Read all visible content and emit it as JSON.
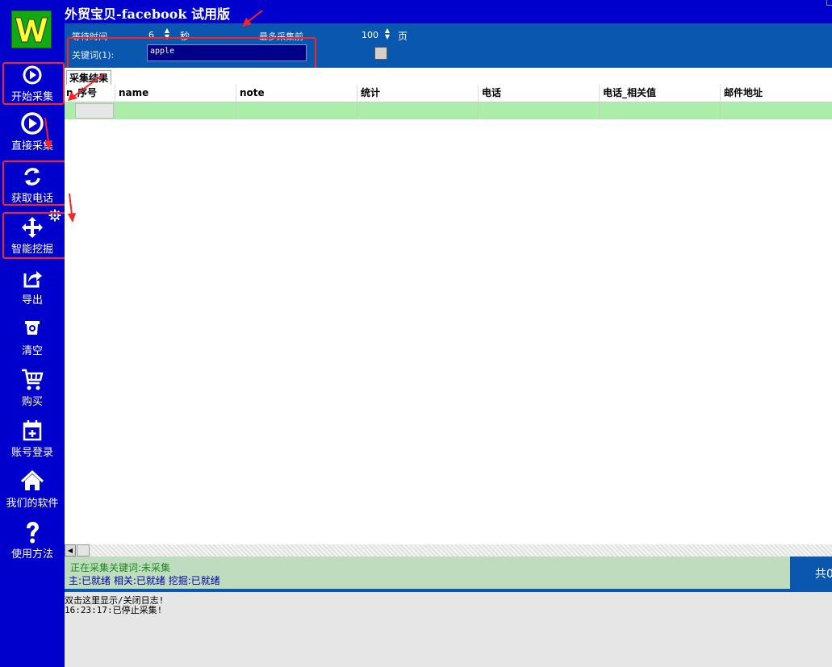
{
  "app": {
    "logo_letter": "W",
    "title": "外贸宝贝-facebook 试用版"
  },
  "sidebar": {
    "items": [
      {
        "label": "开始采集",
        "icon": "play-circle-icon"
      },
      {
        "label": "直接采集",
        "icon": "play-circle-large-icon"
      },
      {
        "label": "获取电话",
        "icon": "refresh-icon"
      },
      {
        "label": "智能挖掘",
        "icon": "move-arrows-icon"
      },
      {
        "label": "导出",
        "icon": "share-export-icon"
      },
      {
        "label": "清空",
        "icon": "trash-icon"
      },
      {
        "label": "购买",
        "icon": "cart-icon"
      },
      {
        "label": "账号登录",
        "icon": "calendar-plus-icon"
      },
      {
        "label": "我们的软件",
        "icon": "home-icon"
      },
      {
        "label": "使用方法",
        "icon": "question-icon"
      }
    ]
  },
  "params": {
    "wait_label": "等待时间",
    "wait_value": "6",
    "wait_unit": "秒",
    "max_label": "最多采集前",
    "max_value": "100",
    "max_unit": "页",
    "keyword_label": "关键词(1):",
    "keyword_value": "apple"
  },
  "results": {
    "tab_label": "采集结果",
    "columns": [
      "n",
      "序号",
      "name",
      "note",
      "统计",
      "电话",
      "电话_相关值",
      "邮件地址"
    ]
  },
  "status": {
    "collecting": "正在采集关键词:未采集",
    "states": "主:已就绪   相关:已就绪   挖掘:已就绪",
    "right_text": "共0"
  },
  "log": {
    "lines": [
      "双击这里显示/关闭日志!",
      "16:23:17:已停止采集!"
    ]
  },
  "colors": {
    "sidebar_bg": "#0000cc",
    "panel_bg": "#0a57b0",
    "row_highlight": "#aaeeaa",
    "status_bg": "#bfdcbf",
    "annotation_red": "#ff2222"
  }
}
